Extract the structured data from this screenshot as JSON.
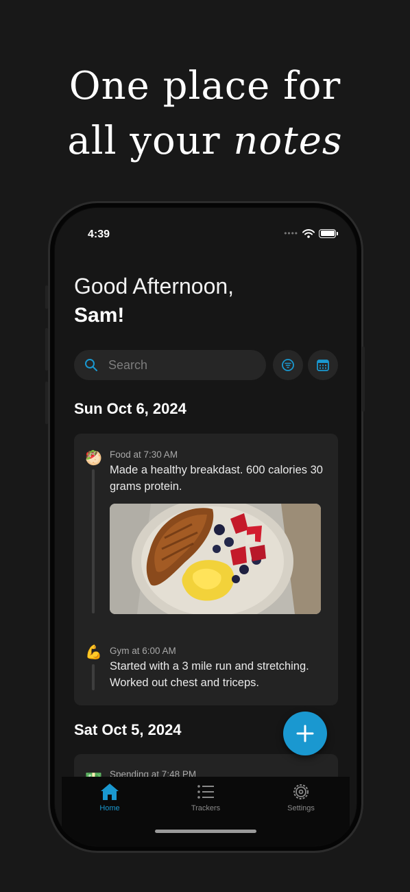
{
  "headline": {
    "line1": "One place for",
    "line2_prefix": "all your ",
    "line2_italic": "notes"
  },
  "status": {
    "time": "4:39",
    "dots": "••••"
  },
  "greeting": {
    "line1": "Good Afternoon,",
    "line2": "Sam!"
  },
  "search": {
    "placeholder": "Search"
  },
  "days": [
    {
      "date": "Sun Oct 6, 2024",
      "entries": [
        {
          "icon": "🥙",
          "meta": "Food at 7:30 AM",
          "text": "Made a healthy breakdast. 600 calories 30 grams protein."
        },
        {
          "icon": "💪",
          "meta": "Gym at 6:00 AM",
          "text": "Started with a 3 mile run and stretching. Worked out chest and triceps."
        }
      ]
    },
    {
      "date": "Sat Oct 5, 2024",
      "entries": [
        {
          "icon": "💵",
          "meta": "Spending at 7:48 PM"
        }
      ]
    }
  ],
  "tabs": [
    {
      "label": "Home",
      "icon": "home-icon",
      "active": true
    },
    {
      "label": "Trackers",
      "icon": "list-icon",
      "active": false
    },
    {
      "label": "Settings",
      "icon": "gear-icon",
      "active": false
    }
  ],
  "colors": {
    "accent": "#1a98d0",
    "background": "#181818",
    "card": "#232323"
  }
}
